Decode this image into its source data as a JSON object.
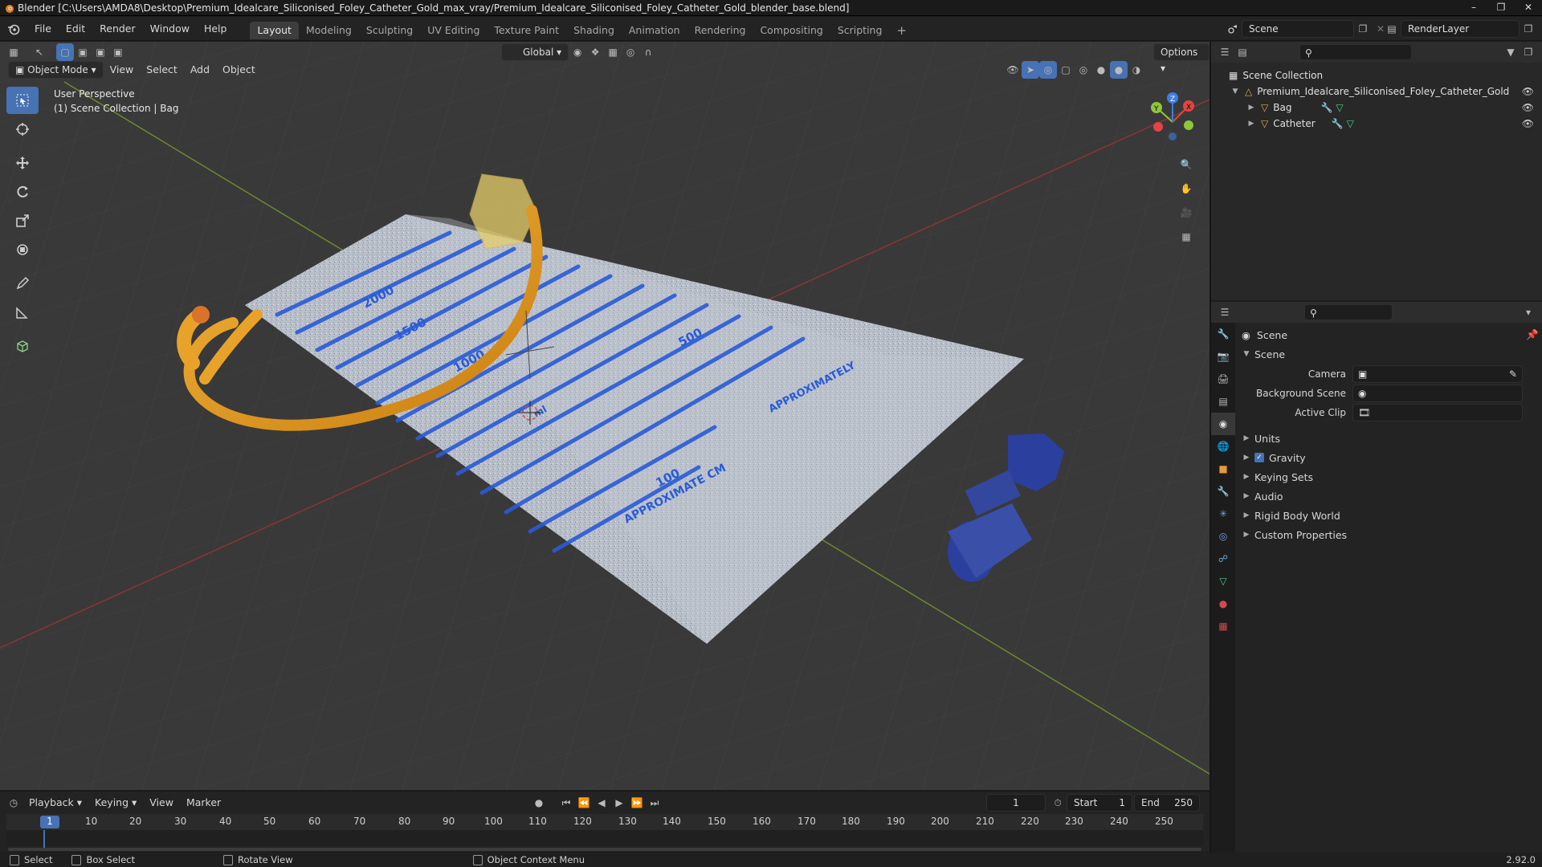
{
  "title": "Blender [C:\\Users\\AMDA8\\Desktop\\Premium_Idealcare_Siliconised_Foley_Catheter_Gold_max_vray/Premium_Idealcare_Siliconised_Foley_Catheter_Gold_blender_base.blend]",
  "menu": [
    "File",
    "Edit",
    "Render",
    "Window",
    "Help"
  ],
  "workspaces": [
    "Layout",
    "Modeling",
    "Sculpting",
    "UV Editing",
    "Texture Paint",
    "Shading",
    "Animation",
    "Rendering",
    "Compositing",
    "Scripting"
  ],
  "active_workspace": "Layout",
  "scene_field": "Scene",
  "renderlayer_field": "RenderLayer",
  "viewport": {
    "mode": "Object Mode",
    "menus": [
      "View",
      "Select",
      "Add",
      "Object"
    ],
    "orientation": "Global",
    "options": "Options",
    "perspective": "User Perspective",
    "collection_info": "(1) Scene Collection | Bag",
    "gizmo_labels": {
      "x": "X",
      "y": "Y",
      "z": "Z"
    }
  },
  "outliner": {
    "root": "Scene Collection",
    "items": [
      {
        "name": "Premium_Idealcare_Siliconised_Foley_Catheter_Gold",
        "level": 1
      },
      {
        "name": "Bag",
        "level": 2
      },
      {
        "name": "Catheter",
        "level": 2
      }
    ]
  },
  "properties": {
    "header": "Scene",
    "panel": "Scene",
    "fields": [
      {
        "label": "Camera",
        "value": ""
      },
      {
        "label": "Background Scene",
        "value": ""
      },
      {
        "label": "Active Clip",
        "value": ""
      }
    ],
    "subpanels": [
      "Units",
      "Gravity",
      "Keying Sets",
      "Audio",
      "Rigid Body World",
      "Custom Properties"
    ],
    "gravity_checked": true
  },
  "timeline": {
    "menus": [
      "Playback",
      "Keying",
      "View",
      "Marker"
    ],
    "current_frame": "1",
    "start_label": "Start",
    "start": "1",
    "end_label": "End",
    "end": "250",
    "ticks": [
      "1",
      "10",
      "20",
      "30",
      "40",
      "50",
      "60",
      "70",
      "80",
      "90",
      "100",
      "110",
      "120",
      "130",
      "140",
      "150",
      "160",
      "170",
      "180",
      "190",
      "200",
      "210",
      "220",
      "230",
      "240",
      "250"
    ]
  },
  "statusbar": {
    "items": [
      "Select",
      "Box Select",
      "Rotate View",
      "Object Context Menu"
    ],
    "version": "2.92.0"
  },
  "bag_labels": {
    "scale": [
      "2000",
      "1500",
      "1000",
      "500",
      "100"
    ],
    "text": [
      "APPROXIMATE CM",
      "APPROXIMATELY"
    ],
    "unit": "ml"
  },
  "colors": {
    "accent": "#4772b3",
    "viewport_bg": "#393939",
    "catheter": "#e8a22a",
    "bag_lines": "#2a5bd7",
    "connector": "#2b3f9e"
  }
}
